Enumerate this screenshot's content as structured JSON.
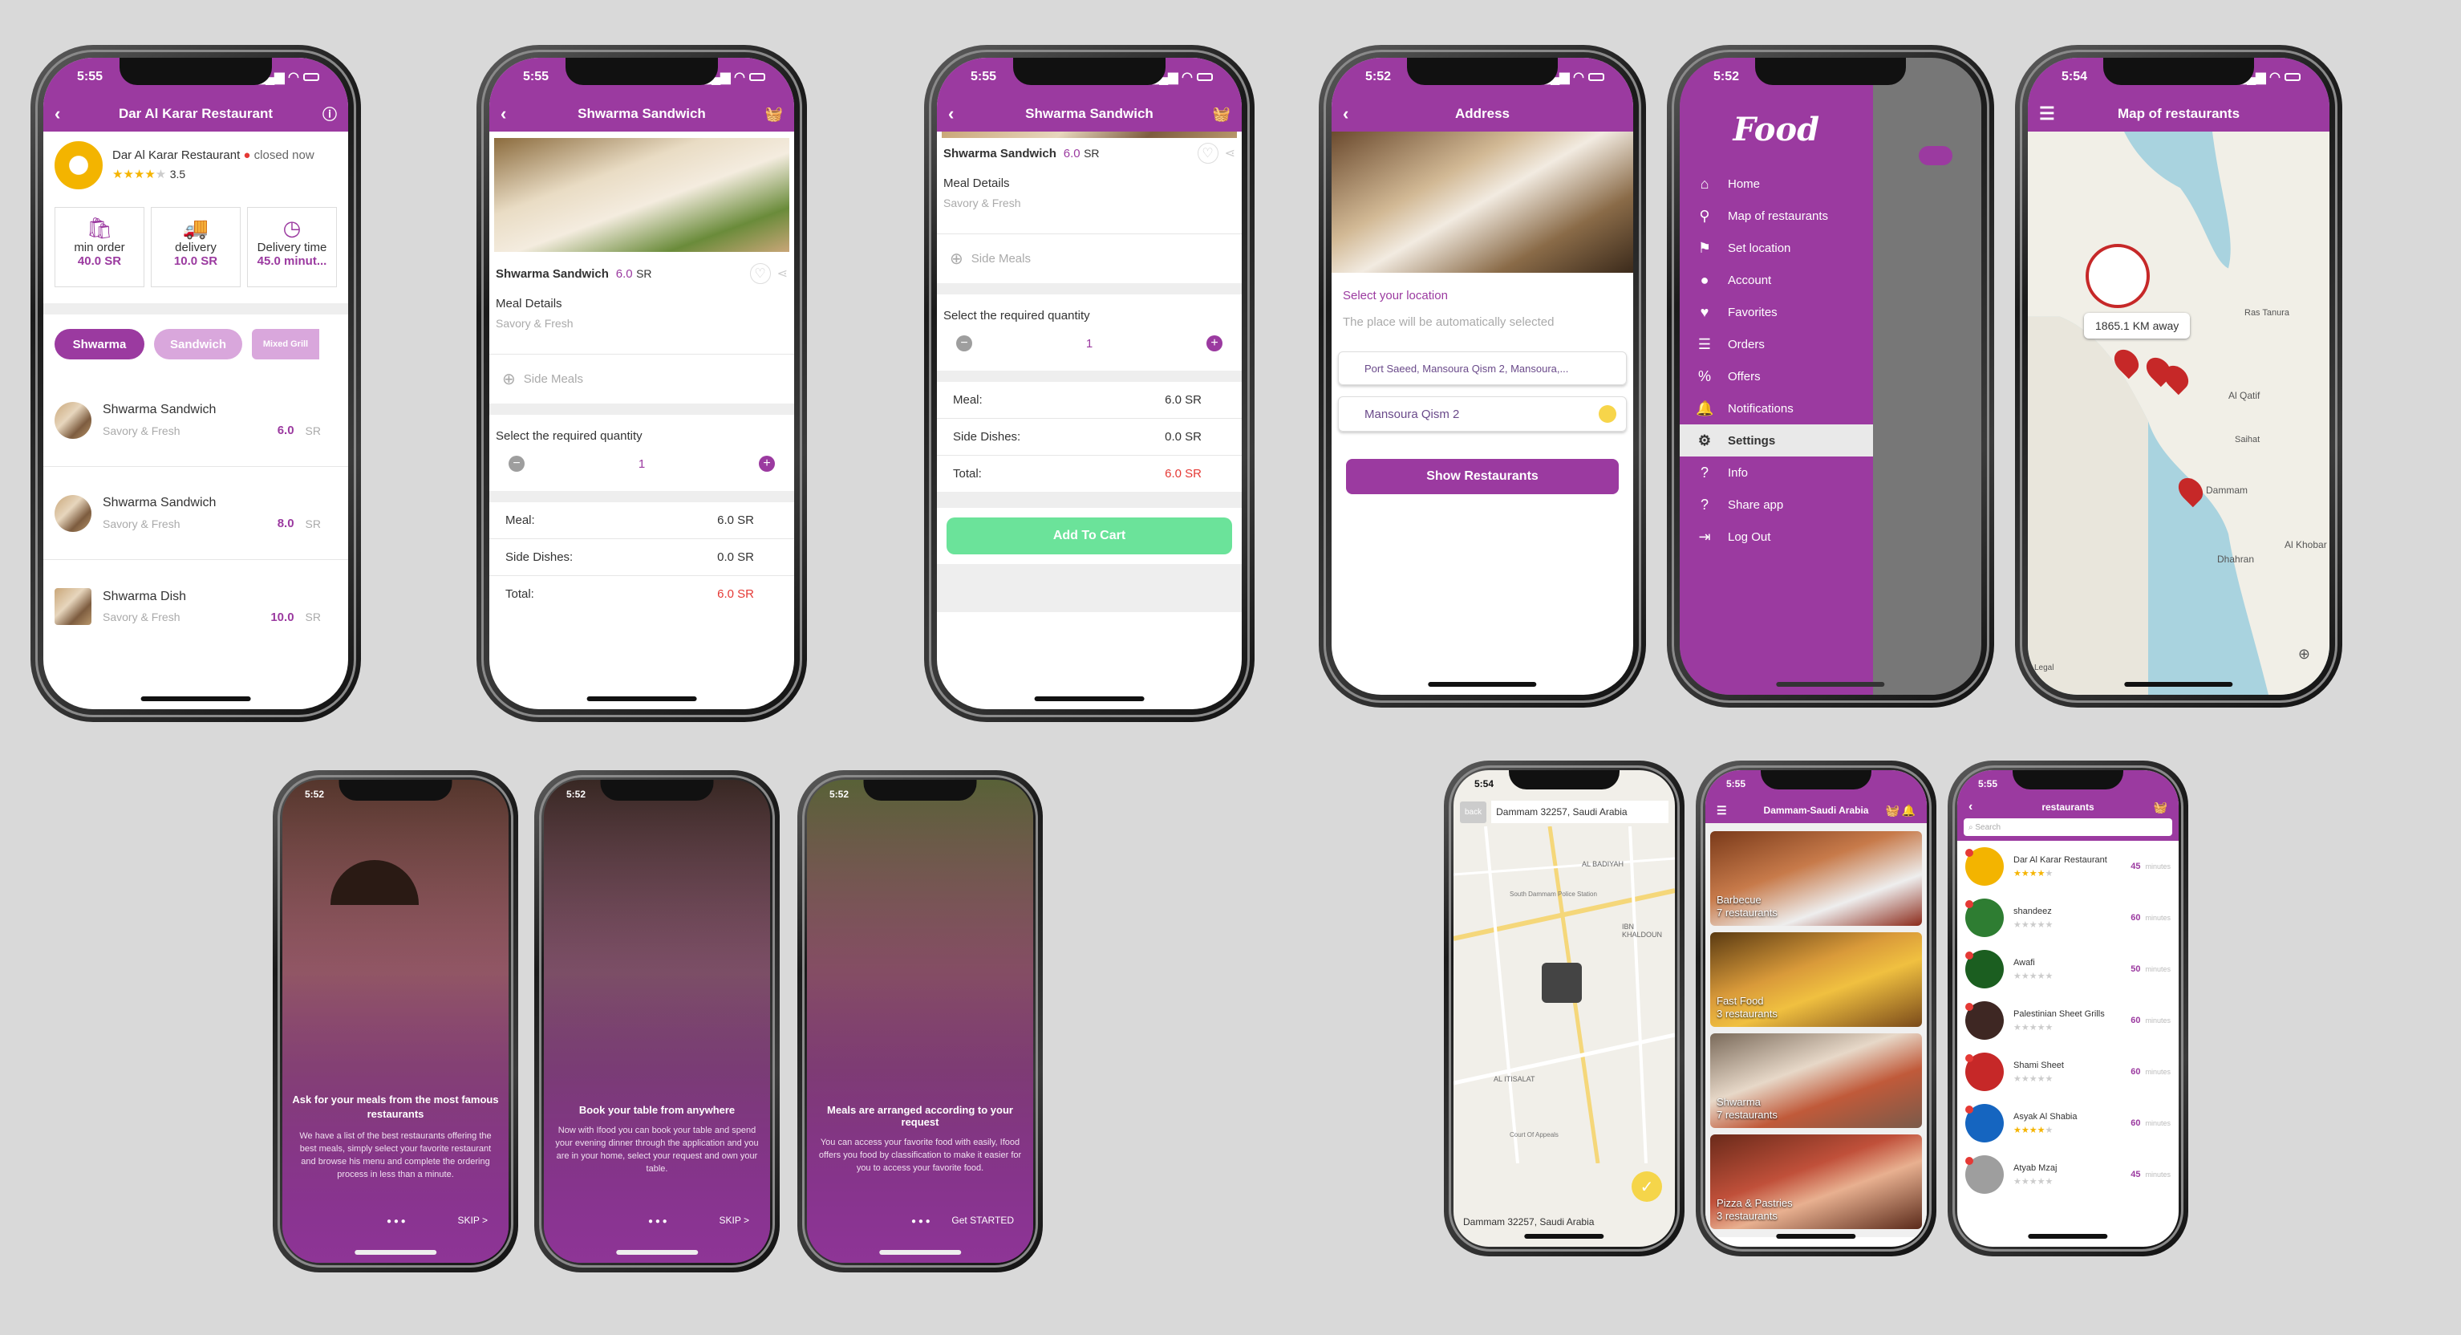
{
  "common": {
    "time_555": "5:55",
    "time_552": "5:52",
    "time_554": "5:54"
  },
  "s1": {
    "title": "Dar Al Karar Restaurant",
    "rest_name": "Dar Al Karar Restaurant",
    "status": "closed now",
    "rating": "3.5",
    "stats": [
      {
        "label": "min order",
        "value": "40.0 SR"
      },
      {
        "label": "delivery",
        "value": "10.0 SR"
      },
      {
        "label": "Delivery time",
        "value": "45.0 minut..."
      }
    ],
    "tabs": [
      "Shwarma",
      "Sandwich",
      "Mixed Grill"
    ],
    "items": [
      {
        "name": "Shwarma Sandwich",
        "desc": "Savory & Fresh",
        "price": "6.0",
        "cur": "SR"
      },
      {
        "name": "Shwarma Sandwich",
        "desc": "Savory & Fresh",
        "price": "8.0",
        "cur": "SR"
      },
      {
        "name": "Shwarma Dish",
        "desc": "Savory & Fresh",
        "price": "10.0",
        "cur": "SR"
      }
    ]
  },
  "s2": {
    "title": "Shwarma Sandwich",
    "name": "Shwarma Sandwich",
    "price": "6.0",
    "cur": "SR",
    "details": "Meal Details",
    "desc": "Savory & Fresh",
    "side": "Side Meals",
    "qty_label": "Select the required quantity",
    "qty": "1",
    "meal_l": "Meal:",
    "meal_v": "6.0 SR",
    "side_l": "Side Dishes:",
    "side_v": "0.0 SR",
    "total_l": "Total:",
    "total_v": "6.0 SR"
  },
  "s3": {
    "title": "Shwarma Sandwich",
    "name": "Shwarma Sandwich",
    "price": "6.0",
    "cur": "SR",
    "details": "Meal Details",
    "desc": "Savory & Fresh",
    "side": "Side Meals",
    "qty_label": "Select the required quantity",
    "qty": "1",
    "meal_l": "Meal:",
    "meal_v": "6.0 SR",
    "side_l": "Side Dishes:",
    "side_v": "0.0 SR",
    "total_l": "Total:",
    "total_v": "6.0 SR",
    "cart": "Add To Cart"
  },
  "s4": {
    "title": "Address",
    "select": "Select your location",
    "auto": "The place will be automatically selected",
    "addr": "Port Saeed, Mansoura Qism 2, Mansoura,...",
    "area": "Mansoura Qism 2",
    "btn": "Show Restaurants"
  },
  "s5": {
    "logo": "Food",
    "items": [
      "Home",
      "Map of restaurants",
      "Set location",
      "Account",
      "Favorites",
      "Orders",
      "Offers",
      "Notifications",
      "Settings",
      "Info",
      "Share app",
      "Log Out"
    ]
  },
  "s6": {
    "title": "Map of restaurants",
    "distance": "1865.1 KM away",
    "places": [
      "Al Qatif",
      "Dammam",
      "Dhahran",
      "Al Khobar",
      "Ras Tanura",
      "Saihat"
    ],
    "legal": "Legal"
  },
  "s7": {
    "title": "Ask for your meals from the most famous restaurants",
    "body": "We have a list of the best restaurants offering the best meals, simply select your favorite restaurant and browse his menu and complete the ordering process in less than a minute.",
    "action": "SKIP >"
  },
  "s8": {
    "title": "Book your table from anywhere",
    "body": "Now with Ifood you can book your table and spend your evening dinner through the application and you are in your home, select your request and own your table.",
    "action": "SKIP >"
  },
  "s9": {
    "title": "Meals are arranged according to your request",
    "body": "You can access your favorite food with easily, Ifood offers you food by classification to make it easier for you to access your favorite food.",
    "action": "Get STARTED"
  },
  "s10": {
    "back": "back",
    "address": "Dammam 32257, Saudi Arabia",
    "places": [
      "AL BADIYAH",
      "IBN KHALDOUN",
      "AL ITISALAT",
      "South Dammam Police Station",
      "Court Of Appeals"
    ]
  },
  "s11": {
    "title": "Dammam-Saudi Arabia",
    "cats": [
      {
        "name": "Barbecue",
        "count": "7 restaurants"
      },
      {
        "name": "Fast Food",
        "count": "3 restaurants"
      },
      {
        "name": "Shwarma",
        "count": "7 restaurants"
      },
      {
        "name": "Pizza & Pastries",
        "count": "3 restaurants"
      }
    ]
  },
  "s12": {
    "title": "restaurants",
    "search": "Search",
    "rests": [
      {
        "name": "Dar Al Karar Restaurant",
        "time": "45",
        "unit": "minutes",
        "stars": 4
      },
      {
        "name": "shandeez",
        "time": "60",
        "unit": "minutes",
        "stars": 0
      },
      {
        "name": "Awafi",
        "time": "50",
        "unit": "minutes",
        "stars": 0
      },
      {
        "name": "Palestinian Sheet Grills",
        "time": "60",
        "unit": "minutes",
        "stars": 0
      },
      {
        "name": "Shami Sheet",
        "time": "60",
        "unit": "minutes",
        "stars": 0
      },
      {
        "name": "Asyak Al Shabia",
        "time": "60",
        "unit": "minutes",
        "stars": 4
      },
      {
        "name": "Atyab Mzaj",
        "time": "45",
        "unit": "minutes",
        "stars": 0
      }
    ]
  },
  "colors": {
    "primary": "#9b3aa0",
    "accent_green": "#6be39a",
    "price_red": "#e53935",
    "star": "#f5b400"
  }
}
